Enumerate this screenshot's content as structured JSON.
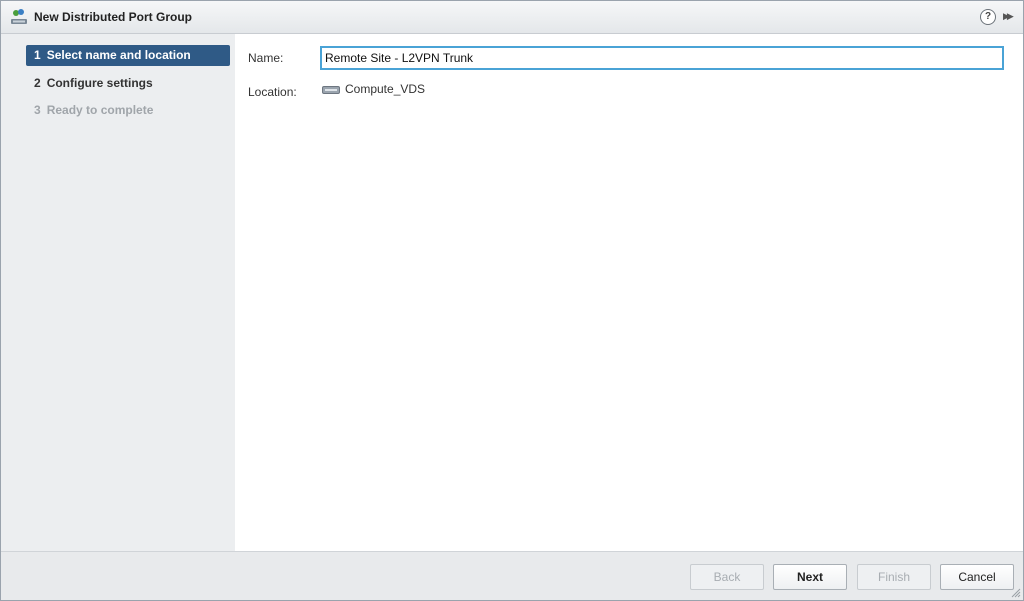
{
  "dialog": {
    "title": "New Distributed Port Group",
    "title_icon": "distributed-port-group-icon",
    "help_label": "?",
    "expand_label": "▶▶"
  },
  "steps": [
    {
      "number": "1",
      "label": "Select name and location",
      "state": "active"
    },
    {
      "number": "2",
      "label": "Configure settings",
      "state": "enabled"
    },
    {
      "number": "3",
      "label": "Ready to complete",
      "state": "disabled"
    }
  ],
  "form": {
    "name_label": "Name:",
    "name_value": "Remote Site - L2VPN Trunk",
    "location_label": "Location:",
    "location_value": "Compute_VDS",
    "location_icon": "vds-switch-icon"
  },
  "footer": {
    "back_label": "Back",
    "next_label": "Next",
    "finish_label": "Finish",
    "cancel_label": "Cancel"
  },
  "colors": {
    "active_step": "#2f5a86",
    "input_focus_border": "#4aa3d6"
  }
}
